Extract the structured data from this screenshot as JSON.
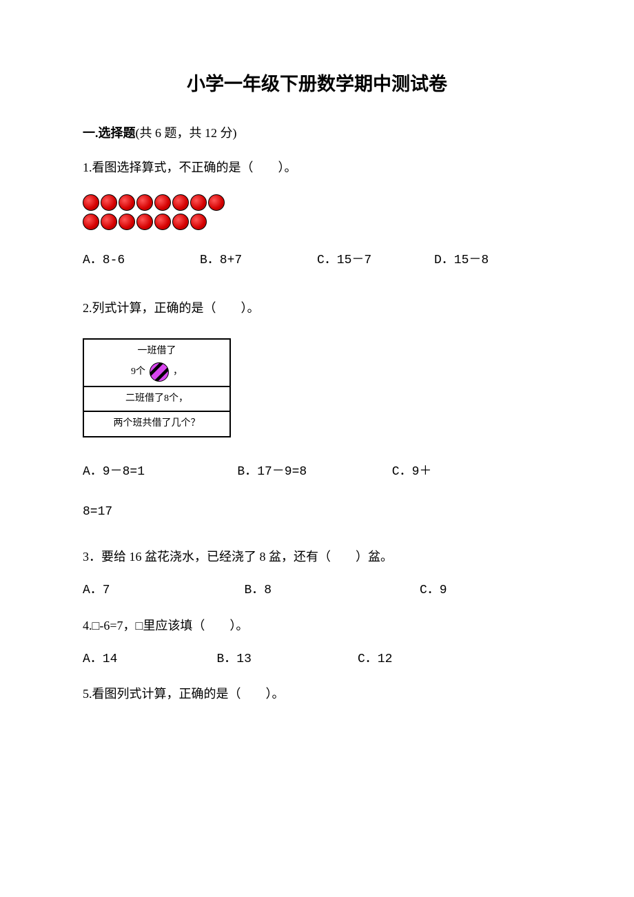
{
  "title": "小学一年级下册数学期中测试卷",
  "section1": {
    "label": "一.选择题",
    "meta": "(共 6 题，共 12 分)"
  },
  "q1": {
    "text": "1.看图选择算式，不正确的是（　　）。",
    "dots_row1": 8,
    "dots_row2": 7,
    "opts": {
      "a": "A．8-6",
      "b": "B．8+7",
      "c": "C．15－7",
      "d": "D．15－8"
    }
  },
  "q2": {
    "text": "2.列式计算，正确的是（　　）。",
    "box": {
      "top_line1": "一班借了",
      "top_count": "9个",
      "top_comma": "，",
      "mid": "二班借了8个，",
      "bot": "两个班共借了几个？"
    },
    "opts": {
      "a": "A．9－8=1",
      "b": "B．17－9=8",
      "c": "C．9＋"
    },
    "cont": "8=17"
  },
  "q3": {
    "text": "3．要给 16 盆花浇水，已经浇了 8 盆，还有（　　）盆。",
    "opts": {
      "a": "A．7",
      "b": "B．8",
      "c": "C．9"
    }
  },
  "q4": {
    "text": "4.□-6=7，□里应该填（　　）。",
    "opts": {
      "a": "A．14",
      "b": "B．13",
      "c": "C．12"
    }
  },
  "q5": {
    "text": "5.看图列式计算，正确的是（　　）。"
  }
}
